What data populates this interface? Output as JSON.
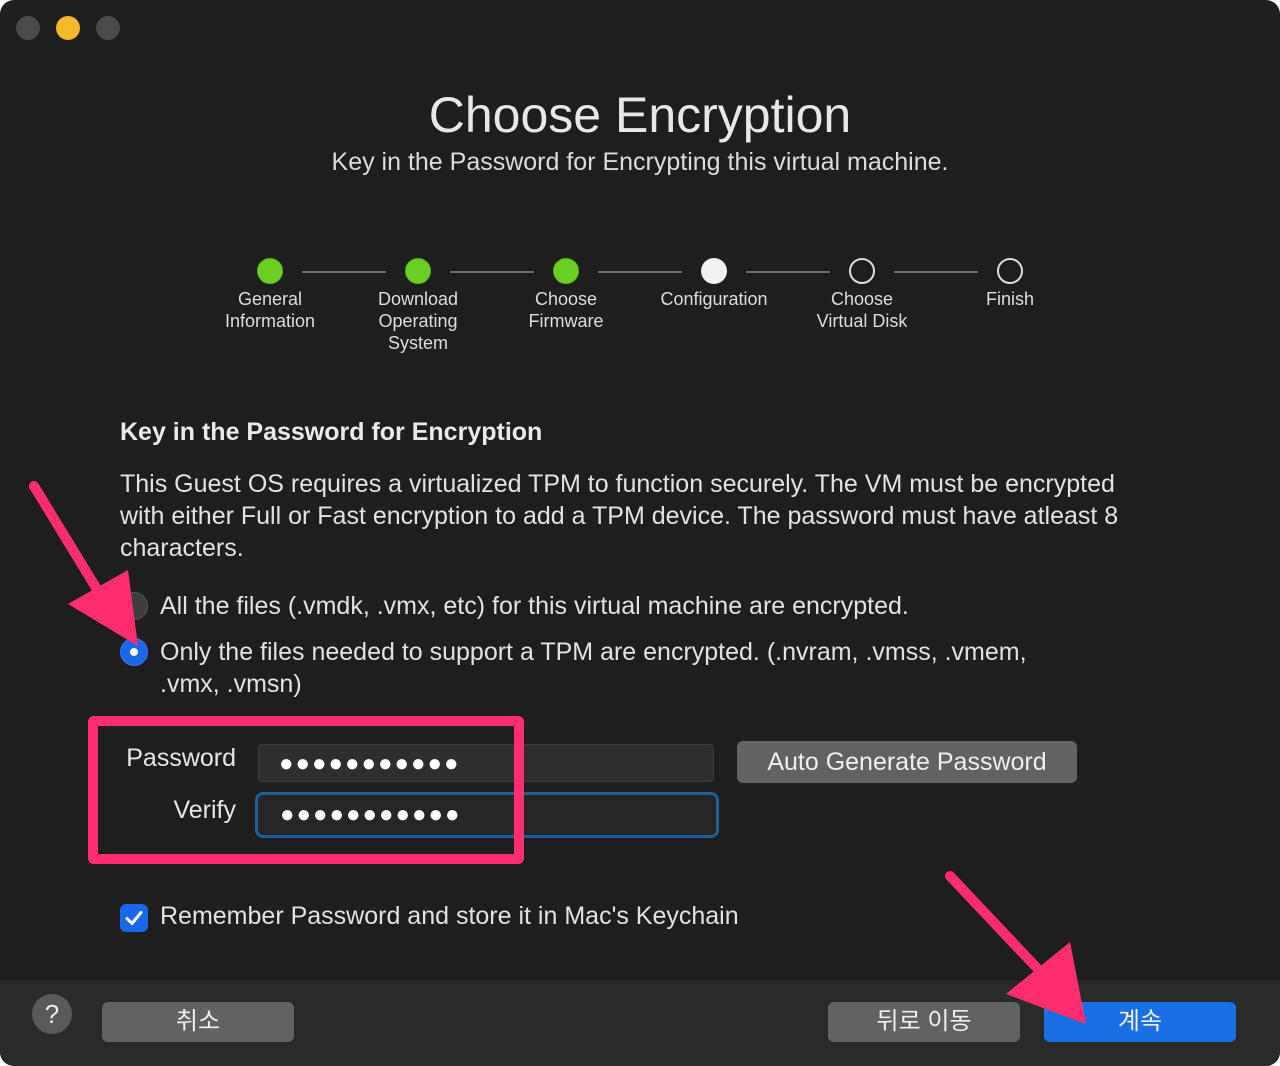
{
  "header": {
    "title": "Choose Encryption",
    "subtitle": "Key in the Password for Encrypting this virtual machine."
  },
  "steps": [
    {
      "label": "General\nInformation",
      "state": "done"
    },
    {
      "label": "Download\nOperating\nSystem",
      "state": "done"
    },
    {
      "label": "Choose\nFirmware",
      "state": "done"
    },
    {
      "label": "Configuration",
      "state": "current"
    },
    {
      "label": "Choose\nVirtual Disk",
      "state": "todo"
    },
    {
      "label": "Finish",
      "state": "todo"
    }
  ],
  "form": {
    "heading": "Key in the Password for Encryption",
    "description": "This Guest OS requires a virtualized TPM to function securely. The VM must be encrypted with either Full or Fast encryption to add a TPM device. The password must have atleast 8 characters.",
    "options": [
      {
        "label": "All the files (.vmdk, .vmx, etc) for this virtual machine are encrypted.",
        "selected": false
      },
      {
        "label": "Only the files needed to support a TPM are encrypted. (.nvram, .vmss, .vmem, .vmx, .vmsn)",
        "selected": true
      }
    ],
    "password_label": "Password",
    "password_value": "●●●●●●●●●●●",
    "verify_label": "Verify",
    "verify_value": "●●●●●●●●●●●",
    "auto_generate_label": "Auto Generate Password",
    "remember_label": "Remember Password and store it in Mac's Keychain",
    "remember_checked": true
  },
  "footer": {
    "help_label": "?",
    "cancel_label": "취소",
    "back_label": "뒤로 이동",
    "continue_label": "계속"
  },
  "colors": {
    "accent": "#1a67e8",
    "step_done": "#6ad124",
    "annotation": "#ff2d6f"
  }
}
